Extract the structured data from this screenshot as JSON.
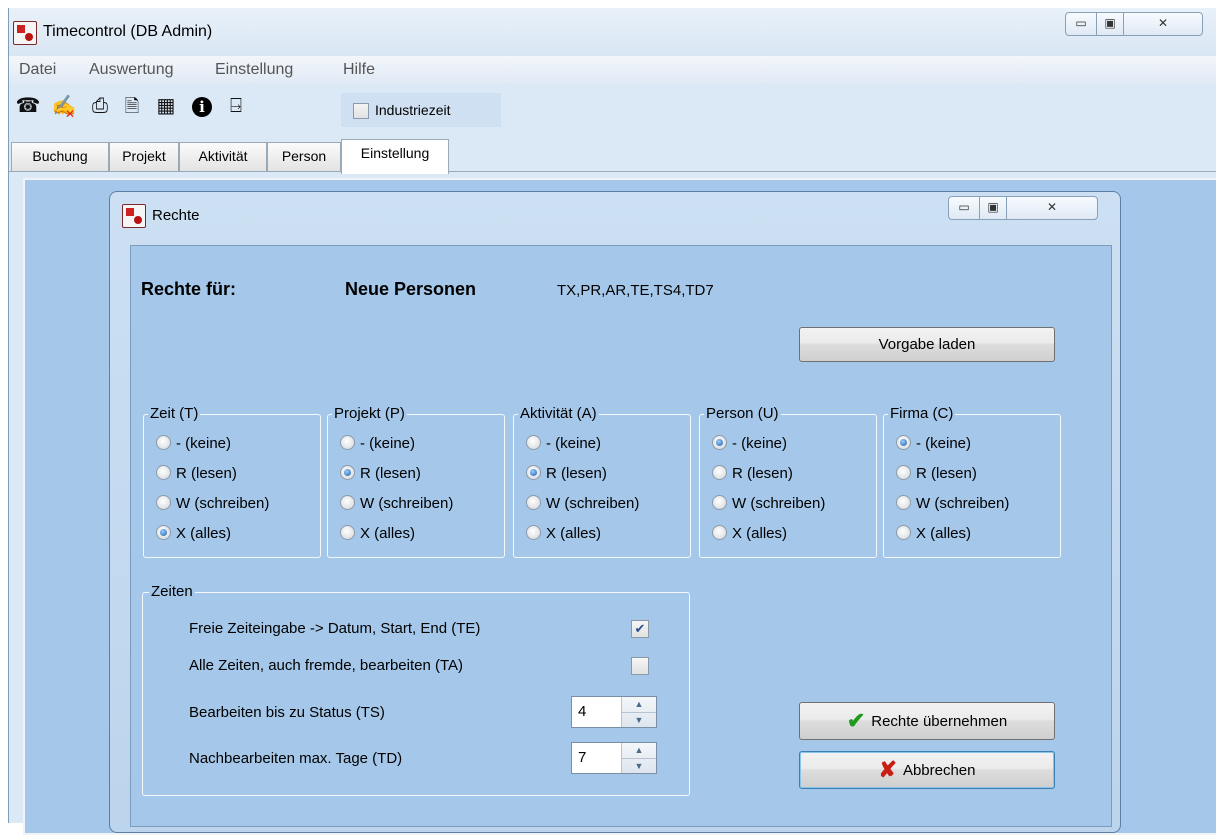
{
  "window": {
    "title": "Timecontrol (DB Admin)",
    "controls": {
      "minimize": "▭",
      "maximize": "▣",
      "close": "✕"
    }
  },
  "menu": [
    "Datei",
    "Auswertung",
    "Einstellung",
    "Hilfe"
  ],
  "toolbar": {
    "icons": [
      "user-login-icon",
      "user-delete-icon",
      "printer-icon",
      "document-icon",
      "calculator-icon",
      "info-icon",
      "exit-door-icon"
    ],
    "industriezeit_label": "Industriezeit",
    "industriezeit_checked": false
  },
  "tabs": [
    {
      "label": "Buchung",
      "active": false
    },
    {
      "label": "Projekt",
      "active": false
    },
    {
      "label": "Aktivität",
      "active": false
    },
    {
      "label": "Person",
      "active": false
    },
    {
      "label": "Einstellung",
      "active": true
    }
  ],
  "dialog": {
    "title": "Rechte",
    "rights_for_label": "Rechte für:",
    "rights_target": "Neue Personen",
    "rights_code": "TX,PR,AR,TE,TS4,TD7",
    "load_default_button": "Vorgabe laden",
    "groups": [
      {
        "legend": "Zeit (T)",
        "options": [
          "- (keine)",
          "R (lesen)",
          "W (schreiben)",
          "X (alles)"
        ],
        "selected": 3
      },
      {
        "legend": "Projekt (P)",
        "options": [
          "- (keine)",
          "R (lesen)",
          "W (schreiben)",
          "X (alles)"
        ],
        "selected": 1
      },
      {
        "legend": "Aktivität (A)",
        "options": [
          "- (keine)",
          "R (lesen)",
          "W (schreiben)",
          "X (alles)"
        ],
        "selected": 1
      },
      {
        "legend": "Person (U)",
        "options": [
          "- (keine)",
          "R (lesen)",
          "W (schreiben)",
          "X (alles)"
        ],
        "selected": 0
      },
      {
        "legend": "Firma (C)",
        "options": [
          "- (keine)",
          "R (lesen)",
          "W (schreiben)",
          "X (alles)"
        ],
        "selected": 0
      }
    ],
    "zeiten": {
      "legend": "Zeiten",
      "free_time_label": "Freie Zeiteingabe -> Datum, Start, End (TE)",
      "free_time_checked": true,
      "all_times_label": "Alle Zeiten, auch fremde, bearbeiten (TA)",
      "all_times_checked": false,
      "status_label": "Bearbeiten bis zu Status (TS)",
      "status_value": "4",
      "days_label": "Nachbearbeiten max. Tage (TD)",
      "days_value": "7"
    },
    "apply_button": "Rechte übernehmen",
    "cancel_button": "Abbrechen"
  }
}
